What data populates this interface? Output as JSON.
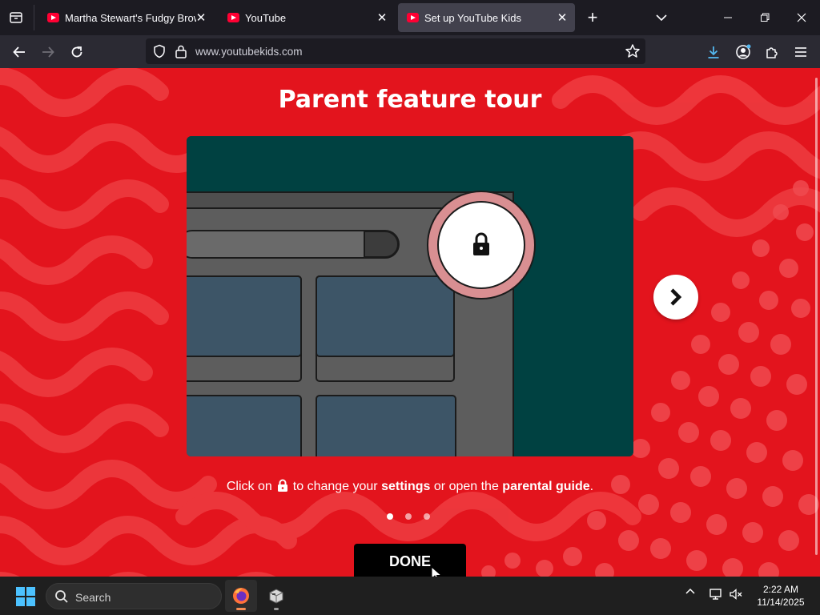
{
  "browser": {
    "tabs": [
      {
        "title": "Martha Stewart's Fudgy Brownie",
        "active": false
      },
      {
        "title": "YouTube",
        "active": false
      },
      {
        "title": "Set up YouTube Kids",
        "active": true
      }
    ],
    "url": "www.youtubekids.com"
  },
  "page": {
    "title": "Parent feature tour",
    "caption": {
      "before": "Click on",
      "middle1": "to change your",
      "settings": "settings",
      "middle2": "or open the",
      "guide": "parental guide",
      "end": "."
    },
    "done_label": "DONE",
    "pager": {
      "count": 3,
      "active_index": 0
    }
  },
  "taskbar": {
    "search_placeholder": "Search",
    "time": "2:22 AM",
    "date": "11/14/2025"
  },
  "colors": {
    "page_background": "#e3141d",
    "card_background": "#004141",
    "lock_ring": "#d98f92"
  }
}
